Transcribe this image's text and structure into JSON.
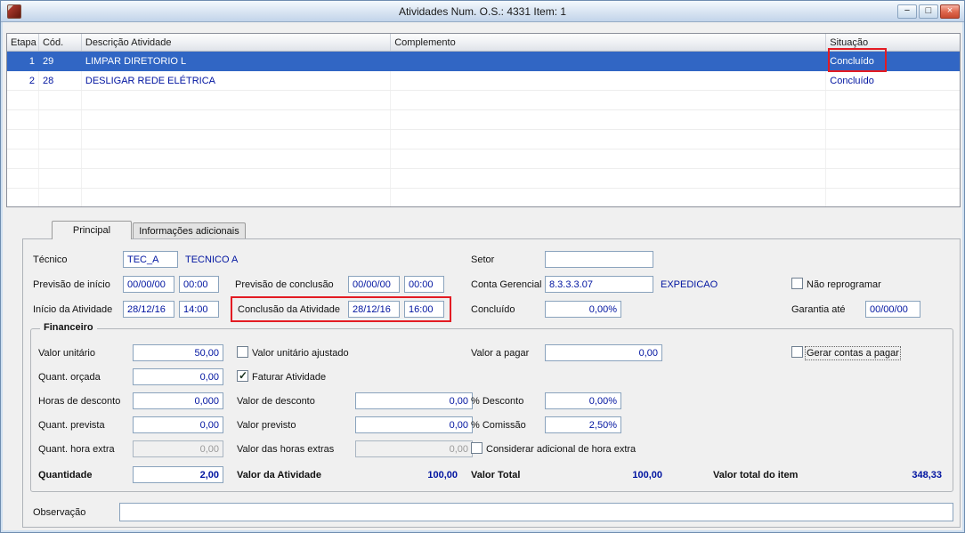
{
  "window": {
    "title": "Atividades Num. O.S.:  4331  Item:  1",
    "controls": {
      "minimize": "−",
      "maximize": "□",
      "close": "×"
    }
  },
  "colors": {
    "selected_row": "#3166c4",
    "data_text": "#0014a0",
    "annotation_red": "#e31b23",
    "titlebar_blue": "#cfdff0"
  },
  "grid": {
    "columns": [
      "Etapa",
      "Cód.",
      "Descrição Atividade",
      "Complemento",
      "Situação"
    ],
    "rows": [
      {
        "etapa": "1",
        "cod": "29",
        "descricao": "LIMPAR DIRETORIO L",
        "complemento": "",
        "situacao": "Concluído",
        "selected": true
      },
      {
        "etapa": "2",
        "cod": "28",
        "descricao": "DESLIGAR REDE ELÉTRICA",
        "complemento": "",
        "situacao": "Concluído",
        "selected": false
      }
    ]
  },
  "tabs": {
    "principal": "Principal",
    "informacoes_adicionais": "Informações adicionais"
  },
  "form": {
    "tecnico": {
      "label": "Técnico",
      "value": "TEC_A",
      "description": "TECNICO A"
    },
    "setor": {
      "label": "Setor",
      "value": ""
    },
    "previsao_inicio": {
      "label": "Previsão de início",
      "date": "00/00/00",
      "time": "00:00"
    },
    "previsao_conclusao": {
      "label": "Previsão de conclusão",
      "date": "00/00/00",
      "time": "00:00"
    },
    "conta_gerencial": {
      "label": "Conta Gerencial",
      "value": "8.3.3.3.07",
      "description": "EXPEDICAO"
    },
    "nao_reprogramar": {
      "label": "Não reprogramar",
      "checked": false
    },
    "inicio_atividade": {
      "label": "Início da Atividade",
      "date": "28/12/16",
      "time": "14:00"
    },
    "conclusao_atividade": {
      "label": "Conclusão da Atividade",
      "date": "28/12/16",
      "time": "16:00"
    },
    "concluido": {
      "label": "Concluído",
      "value": "0,00%"
    },
    "garantia_ate": {
      "label": "Garantia até",
      "value": "00/00/00"
    }
  },
  "financeiro": {
    "legend": "Financeiro",
    "valor_unitario": {
      "label": "Valor unitário",
      "value": "50,00"
    },
    "valor_unitario_ajustado": {
      "label": "Valor unitário ajustado",
      "checked": false
    },
    "valor_a_pagar": {
      "label": "Valor a pagar",
      "value": "0,00"
    },
    "gerar_contas_a_pagar": {
      "label": "Gerar contas a pagar",
      "checked": false
    },
    "quant_orcada": {
      "label": "Quant. orçada",
      "value": "0,00"
    },
    "faturar_atividade": {
      "label": "Faturar Atividade",
      "checked": true
    },
    "horas_de_desconto": {
      "label": "Horas de desconto",
      "value": "0,000"
    },
    "valor_de_desconto": {
      "label": "Valor de desconto",
      "value": "0,00"
    },
    "pct_desconto": {
      "label": "% Desconto",
      "value": "0,00%"
    },
    "quant_prevista": {
      "label": "Quant. prevista",
      "value": "0,00"
    },
    "valor_previsto": {
      "label": "Valor previsto",
      "value": "0,00"
    },
    "pct_comissao": {
      "label": "% Comissão",
      "value": "2,50%"
    },
    "quant_hora_extra": {
      "label": "Quant. hora extra",
      "value": "0,00"
    },
    "valor_horas_extras": {
      "label": "Valor das horas extras",
      "value": "0,00"
    },
    "considerar_adicional_hora_extra": {
      "label": "Considerar adicional de hora extra",
      "checked": false
    },
    "quantidade": {
      "label": "Quantidade",
      "value": "2,00"
    },
    "valor_da_atividade": {
      "label": "Valor da Atividade",
      "value": "100,00"
    },
    "valor_total": {
      "label": "Valor Total",
      "value": "100,00"
    },
    "valor_total_do_item": {
      "label": "Valor total do item",
      "value": "348,33"
    }
  },
  "observacao": {
    "label": "Observação",
    "value": ""
  }
}
